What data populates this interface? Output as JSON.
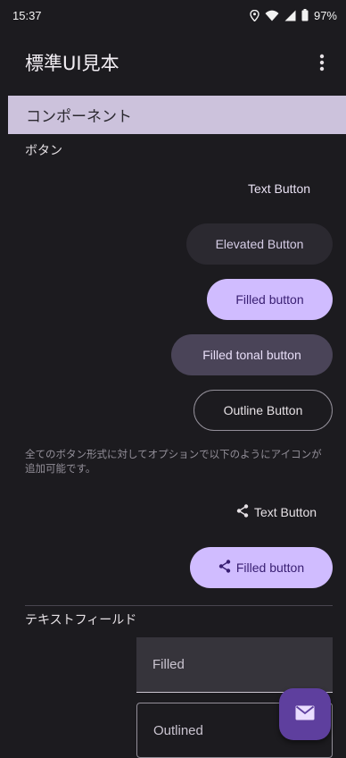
{
  "status_bar": {
    "time": "15:37",
    "battery": "97%",
    "icons": [
      "location-icon",
      "wifi-icon",
      "signal-icon",
      "battery-icon"
    ]
  },
  "app_bar": {
    "title": "標準UI見本",
    "menu_icon": "more-vert-icon"
  },
  "section": {
    "title": "コンポーネント"
  },
  "buttons_section": {
    "heading": "ボタン",
    "text_button": "Text Button",
    "elevated_button": "Elevated Button",
    "filled_button": "Filled button",
    "tonal_button": "Filled tonal button",
    "outline_button": "Outline Button",
    "description": "全てのボタン形式に対してオプションで以下のようにアイコンが追加可能です。",
    "text_button_icon": "Text Button",
    "filled_button_icon": "Filled button",
    "icon_name": "share-icon"
  },
  "textfield_section": {
    "heading": "テキストフィールド",
    "filled_placeholder": "Filled",
    "outlined_placeholder": "Outlined"
  },
  "fab": {
    "icon": "mail-icon"
  },
  "colors": {
    "background": "#1c1b1f",
    "primary": "#d0bcff",
    "on_primary": "#381e72",
    "section_header": "#ccc2dc",
    "fab": "#5e3f9e"
  }
}
